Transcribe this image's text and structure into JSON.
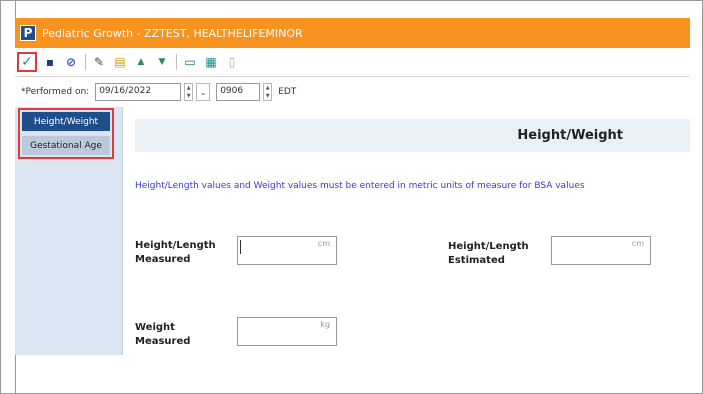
{
  "window": {
    "app_icon_letter": "P",
    "title": "Pediatric Growth - ZZTEST, HEALTHELIFEMINOR"
  },
  "toolbar": {
    "buttons": [
      {
        "name": "sign-button",
        "icon": "checkmark-icon",
        "glyph": "✓"
      },
      {
        "name": "save-button",
        "icon": "floppy-disk-icon",
        "glyph": "▪"
      },
      {
        "name": "cancel-button",
        "icon": "no-entry-icon",
        "glyph": "⊘"
      },
      {
        "name": "tools-button",
        "icon": "wand-icon",
        "glyph": "✎"
      },
      {
        "name": "document-button",
        "icon": "document-icon",
        "glyph": "▤"
      },
      {
        "name": "previous-button",
        "icon": "arrow-up-icon",
        "glyph": "▲"
      },
      {
        "name": "next-button",
        "icon": "arrow-down-icon",
        "glyph": "▼"
      },
      {
        "name": "comment-button",
        "icon": "comment-icon",
        "glyph": "▭"
      },
      {
        "name": "calculator-button",
        "icon": "calculator-icon",
        "glyph": "▦"
      },
      {
        "name": "print-button",
        "icon": "page-icon",
        "glyph": "▯"
      }
    ]
  },
  "datebar": {
    "label": "*Performed on:",
    "date_value": "09/16/2022",
    "time_value": "0906",
    "timezone": "EDT"
  },
  "nav": {
    "items": [
      {
        "label": "Height/Weight",
        "active": true
      },
      {
        "label": "Gestational Age",
        "active": false
      }
    ]
  },
  "section": {
    "title": "Height/Weight",
    "note": "Height/Length values and Weight values must be entered in metric units of measure for BSA values"
  },
  "fields": {
    "height_measured": {
      "label_line1": "Height/Length",
      "label_line2": "Measured",
      "unit": "cm",
      "value": ""
    },
    "height_estimated": {
      "label_line1": "Height/Length",
      "label_line2": "Estimated",
      "unit": "cm",
      "value": ""
    },
    "weight_measured": {
      "label_line1": "Weight",
      "label_line2": "Measured",
      "unit": "kg",
      "value": ""
    }
  },
  "colors": {
    "titlebar": "#f7931e",
    "nav_active": "#1f4e8a",
    "highlight_border": "#e03a3a",
    "note_text": "#3a3ad8"
  }
}
